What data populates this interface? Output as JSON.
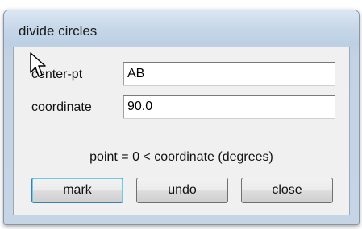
{
  "window": {
    "title": "divide circles"
  },
  "form": {
    "center_pt_label": "center-pt",
    "center_pt_value": "AB",
    "coordinate_label": "coordinate",
    "coordinate_value": "90.0",
    "info_text": "point = 0  <  coordinate  (degrees)"
  },
  "buttons": {
    "mark": "mark",
    "undo": "undo",
    "close": "close"
  },
  "colors": {
    "title_bar": "#c5d6e8",
    "client_background": "#f0f0f0",
    "default_button_border": "#3c7fb1"
  },
  "icons": {
    "pointer": "arrow-cursor-icon"
  }
}
